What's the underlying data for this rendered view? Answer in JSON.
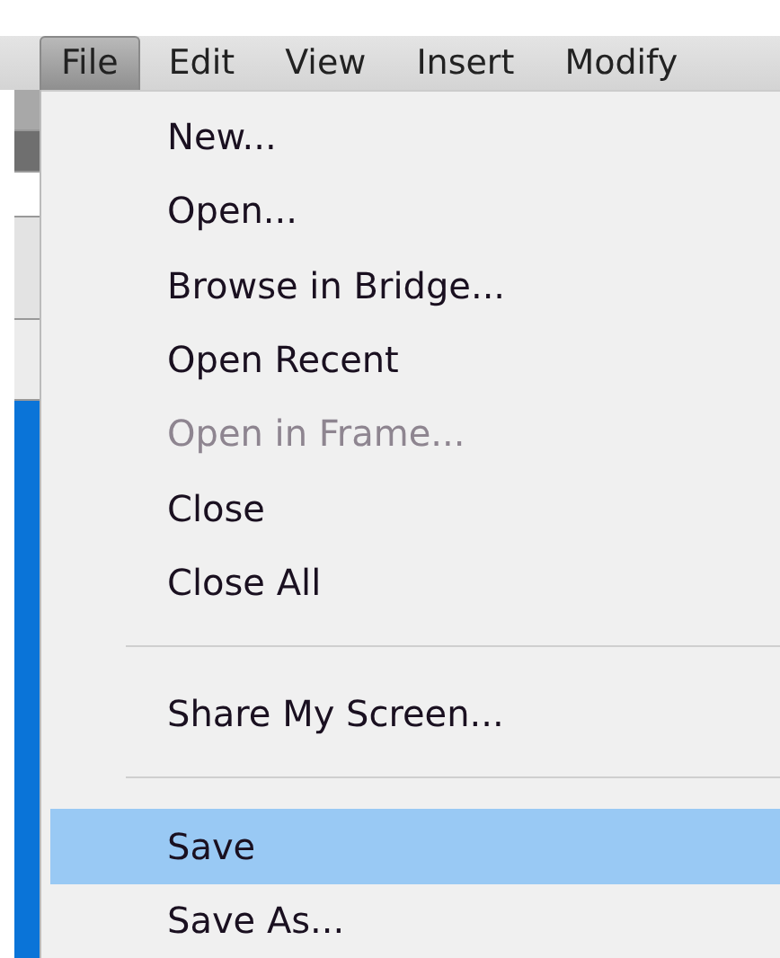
{
  "menubar": [
    {
      "label": "File",
      "selected": true
    },
    {
      "label": "Edit",
      "selected": false
    },
    {
      "label": "View",
      "selected": false
    },
    {
      "label": "Insert",
      "selected": false
    },
    {
      "label": "Modify",
      "selected": false
    }
  ],
  "menu": [
    {
      "kind": "item",
      "label": "New...",
      "disabled": false,
      "selected": false
    },
    {
      "kind": "item",
      "label": "Open...",
      "disabled": false,
      "selected": false
    },
    {
      "kind": "item",
      "label": "Browse in Bridge...",
      "disabled": false,
      "selected": false
    },
    {
      "kind": "item",
      "label": "Open Recent",
      "disabled": false,
      "selected": false
    },
    {
      "kind": "item",
      "label": "Open in Frame...",
      "disabled": true,
      "selected": false
    },
    {
      "kind": "item",
      "label": "Close",
      "disabled": false,
      "selected": false
    },
    {
      "kind": "item",
      "label": "Close All",
      "disabled": false,
      "selected": false
    },
    {
      "kind": "separator"
    },
    {
      "kind": "item",
      "label": "Share My Screen...",
      "disabled": false,
      "selected": false
    },
    {
      "kind": "separator"
    },
    {
      "kind": "item",
      "label": "Save",
      "disabled": false,
      "selected": true
    },
    {
      "kind": "item",
      "label": "Save As...",
      "disabled": false,
      "selected": false
    }
  ]
}
